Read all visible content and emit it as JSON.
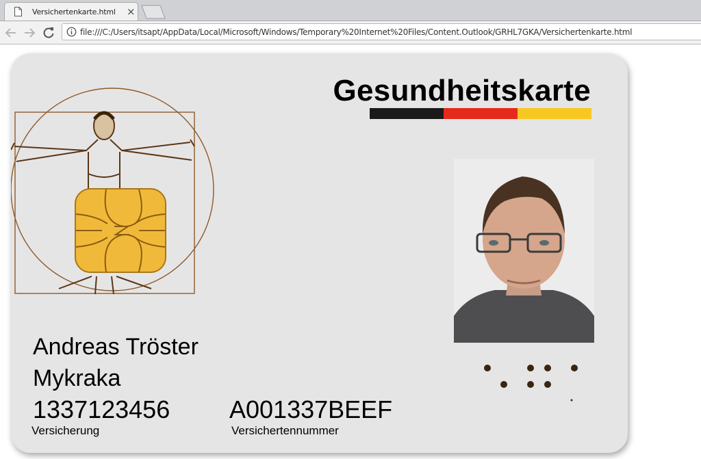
{
  "browser": {
    "tab_title": "Versichertenkarte.html",
    "tab_close": "×",
    "url": "file:///C:/Users/itsapt/AppData/Local/Microsoft/Windows/Temporary%20Internet%20Files/Content.Outlook/GRHL7GKA/Versichertenkarte.html",
    "icons": [
      "document-icon",
      "close-icon",
      "new-tab-icon",
      "back-icon",
      "forward-icon",
      "reload-icon",
      "info-icon"
    ]
  },
  "card": {
    "title": "Gesundheitskarte",
    "flag_colors": [
      "#1a1a1a",
      "#e52a1c",
      "#f7c822"
    ],
    "holder_name": "Andreas Tröster",
    "insurer": "Mykraka",
    "insurance_number": "1337123456",
    "insurance_label": "Versicherung",
    "insured_number": "A001337BEEF",
    "insured_label": "Versichertennummer",
    "chip_color": "#f1b93a",
    "background_color": "#e6e5e6"
  }
}
